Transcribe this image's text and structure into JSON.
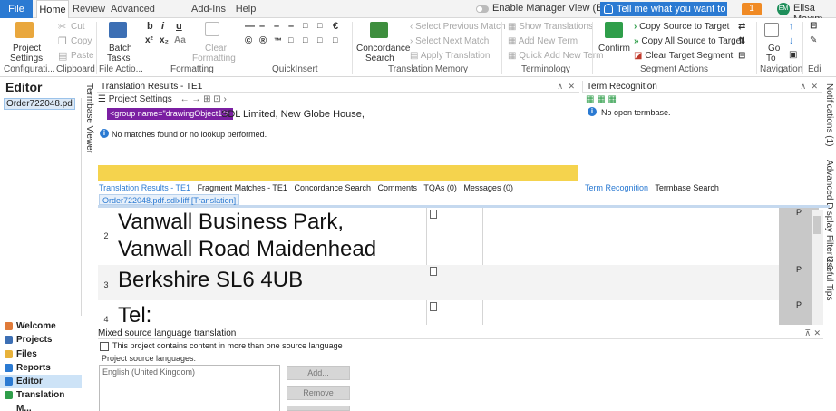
{
  "menu": {
    "tabs": [
      "File",
      "Home",
      "Review",
      "Advanced",
      "Add-Ins",
      "Help"
    ],
    "manager_view": "Enable Manager View (Beta)",
    "tell_me": "Tell me what you want to do...",
    "notifications": "1",
    "user_initials": "EM",
    "user_name": "Elisa Maxim"
  },
  "ribbon": {
    "configuration": {
      "project_settings_1": "Project",
      "project_settings_2": "Settings",
      "group": "Configurati..."
    },
    "clipboard": {
      "cut": "Cut",
      "copy": "Copy",
      "paste": "Paste",
      "group": "Clipboard"
    },
    "file_actions": {
      "batch_tasks_1": "Batch",
      "batch_tasks_2": "Tasks",
      "group": "File Actio..."
    },
    "formatting": {
      "bold": "b",
      "italic": "i",
      "underline": "u",
      "superscript": "x²",
      "subscript": "x₂",
      "case": "Aa",
      "clear_1": "Clear",
      "clear_2": "Formatting",
      "group": "Formatting"
    },
    "quickinsert": {
      "row1": [
        "—",
        "–",
        "–",
        "–",
        "□",
        "□",
        "€"
      ],
      "row2": [
        "©",
        "®",
        "™",
        "□",
        "□",
        "□",
        "□"
      ],
      "group": "QuickInsert"
    },
    "translation_memory": {
      "concordance_1": "Concordance",
      "concordance_2": "Search",
      "select_prev": "Select Previous Match",
      "select_next": "Select Next Match",
      "apply": "Apply Translation",
      "group": "Translation Memory"
    },
    "terminology": {
      "show": "Show Translations",
      "add_new": "Add New Term",
      "quick_add": "Quick Add New Term",
      "group": "Terminology"
    },
    "segment_actions": {
      "confirm": "Confirm",
      "copy_source": "Copy Source to Target",
      "copy_all": "Copy All Source to Target",
      "clear_target": "Clear Target Segment",
      "group": "Segment Actions"
    },
    "navigation": {
      "go_to_1": "Go",
      "go_to_2": "To",
      "group": "Navigation"
    },
    "editing": {
      "group": "Edi"
    }
  },
  "nav": {
    "header": "Editor",
    "file": "Order722048.pd",
    "items": [
      "Welcome",
      "Projects",
      "Files",
      "Reports",
      "Editor",
      "Translation M..."
    ]
  },
  "termbase_viewer": "Termbase Viewer",
  "translation_results": {
    "title": "Translation Results - TE1",
    "project_settings": "Project Settings",
    "group_tag": "<group name=\"drawingObject1\">",
    "source": "SDL Limited, New Globe House,",
    "message": "No matches found or no lookup performed."
  },
  "bottom_tabs": [
    "Translation Results - TE1",
    "Fragment Matches - TE1",
    "Concordance Search",
    "Comments",
    "TQAs (0)",
    "Messages (0)"
  ],
  "term_recognition": {
    "title": "Term Recognition",
    "message": "No open termbase.",
    "tabs": [
      "Term Recognition",
      "Termbase Search"
    ]
  },
  "right_strip": [
    "Notifications (1)",
    "Advanced Display Filter 2.0",
    "Useful Tips"
  ],
  "document": {
    "tab": "Order722048.pdf.sdlxliff [Translation]",
    "rows": [
      {
        "num": "2",
        "source_lines": [
          "Vanwall Business Park,",
          "Vanwall Road Maidenhead"
        ],
        "status": "P"
      },
      {
        "num": "3",
        "source_lines": [
          "Berkshire SL6 4UB"
        ],
        "status": "P"
      },
      {
        "num": "4",
        "source_lines": [
          "Tel:"
        ],
        "status": "P"
      }
    ]
  },
  "mixed_source": {
    "title": "Mixed source language translation",
    "checkbox": "This project contains content in more than one source language",
    "languages_label": "Project source languages:",
    "languages": [
      "English (United Kingdom)"
    ],
    "add": "Add...",
    "remove": "Remove"
  }
}
